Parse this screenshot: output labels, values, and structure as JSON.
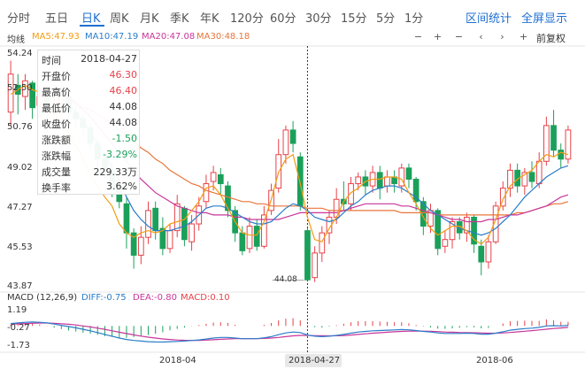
{
  "tabs": [
    {
      "label": "分时"
    },
    {
      "label": "五日"
    },
    {
      "label": "日K"
    },
    {
      "label": "周K"
    },
    {
      "label": "月K"
    },
    {
      "label": "季K"
    },
    {
      "label": "年K"
    },
    {
      "label": "120分"
    },
    {
      "label": "60分"
    },
    {
      "label": "30分"
    },
    {
      "label": "15分"
    },
    {
      "label": "5分"
    },
    {
      "label": "1分"
    }
  ],
  "active_tab": "日K",
  "right_links": {
    "range_stats": "区间统计",
    "fullscreen": "全屏显示"
  },
  "ma_legend": {
    "title": "均线",
    "ma5": "MA5:47.93",
    "ma10": "MA10:47.19",
    "ma20": "MA20:47.08",
    "ma30": "MA30:48.18"
  },
  "controls": {
    "minus1": "−",
    "plus1": "+",
    "minus2": "−",
    "prev": "‹",
    "next": "›",
    "plus2": "+",
    "fuquan": "前复权"
  },
  "colors": {
    "ma5": "#f39c12",
    "ma10": "#2a7dc9",
    "ma20": "#c8369a",
    "ma30": "#e8753a",
    "up": "#e8424a",
    "down": "#1aa05a",
    "diff": "#2a7dc9",
    "dea": "#c8369a",
    "macd": "#e8424a"
  },
  "price_axis": {
    "labels": [
      "54.24",
      "52.50",
      "50.76",
      "49.02",
      "47.27",
      "45.53",
      "43.87"
    ]
  },
  "macd_axis": {
    "labels": [
      "1.19",
      "-0.27",
      "-1.73"
    ]
  },
  "x_axis": {
    "labels": [
      "2018-04",
      "2018-04-27",
      "2018-06"
    ]
  },
  "low_marker": "44.08",
  "tooltip": [
    {
      "key": "时间",
      "value": "2018-04-27",
      "color": "#333"
    },
    {
      "key": "开盘价",
      "value": "46.30",
      "color": "#e8424a"
    },
    {
      "key": "最高价",
      "value": "46.40",
      "color": "#e8424a"
    },
    {
      "key": "最低价",
      "value": "44.08",
      "color": "#333"
    },
    {
      "key": "收盘价",
      "value": "44.08",
      "color": "#333"
    },
    {
      "key": "涨跌额",
      "value": "-1.50",
      "color": "#1aa05a"
    },
    {
      "key": "涨跌幅",
      "value": "-3.29%",
      "color": "#1aa05a"
    },
    {
      "key": "成交量",
      "value": "229.33万",
      "color": "#333"
    },
    {
      "key": "换手率",
      "value": "3.62%",
      "color": "#333"
    }
  ],
  "macd_legend": {
    "title": "MACD (12,26,9)",
    "diff": "DIFF:-0.75",
    "dea": "DEA:-0.80",
    "macd": "MACD:0.10"
  },
  "chart_data": [
    {
      "type": "candlestick",
      "ylim": [
        43.87,
        54.24
      ],
      "candles": [
        [
          51.6,
          53.3,
          53.9,
          51.0
        ],
        [
          52.8,
          52.4,
          53.3,
          51.5
        ],
        [
          52.3,
          53.0,
          53.3,
          51.7
        ],
        [
          52.9,
          51.8,
          53.0,
          51.3
        ],
        [
          51.9,
          52.3,
          52.8,
          51.4
        ],
        [
          52.3,
          51.8,
          52.5,
          51.2
        ],
        [
          51.7,
          52.0,
          52.4,
          51.1
        ],
        [
          52.0,
          52.5,
          52.8,
          51.8
        ],
        [
          52.3,
          51.6,
          52.4,
          51.2
        ],
        [
          51.6,
          51.3,
          51.9,
          50.9
        ],
        [
          51.3,
          50.9,
          51.5,
          50.5
        ],
        [
          50.9,
          50.2,
          51.1,
          49.9
        ],
        [
          50.2,
          49.5,
          50.4,
          49.1
        ],
        [
          49.5,
          49.0,
          49.8,
          48.6
        ],
        [
          49.0,
          48.2,
          49.3,
          47.8
        ],
        [
          48.2,
          47.6,
          48.6,
          47.3
        ],
        [
          47.5,
          46.2,
          47.8,
          45.5
        ],
        [
          46.2,
          45.2,
          46.4,
          44.6
        ],
        [
          45.2,
          46.0,
          46.5,
          44.8
        ],
        [
          46.0,
          47.2,
          47.6,
          45.7
        ],
        [
          47.3,
          46.3,
          47.6,
          45.9
        ],
        [
          46.4,
          45.5,
          46.9,
          45.2
        ],
        [
          45.5,
          46.3,
          46.6,
          45.3
        ],
        [
          46.3,
          47.5,
          47.9,
          46.0
        ],
        [
          47.3,
          45.9,
          47.4,
          45.6
        ],
        [
          45.8,
          46.6,
          47.0,
          45.4
        ],
        [
          46.6,
          47.4,
          47.8,
          46.3
        ],
        [
          47.6,
          48.4,
          48.8,
          47.3
        ],
        [
          48.5,
          48.9,
          49.2,
          48.1
        ],
        [
          48.8,
          48.4,
          49.1,
          47.9
        ],
        [
          48.3,
          47.2,
          48.5,
          46.9
        ],
        [
          47.2,
          46.2,
          47.4,
          45.8
        ],
        [
          46.2,
          45.4,
          46.5,
          45.2
        ],
        [
          45.5,
          46.5,
          46.9,
          45.3
        ],
        [
          46.5,
          45.6,
          46.8,
          45.4
        ],
        [
          45.6,
          47.0,
          47.4,
          45.5
        ],
        [
          47.2,
          48.1,
          48.4,
          47.0
        ],
        [
          48.2,
          49.7,
          50.4,
          48.0
        ],
        [
          49.7,
          50.8,
          51.0,
          49.3
        ],
        [
          50.8,
          50.2,
          51.2,
          49.8
        ],
        [
          49.6,
          47.4,
          49.8,
          47.2
        ],
        [
          46.3,
          44.1,
          46.4,
          44.1
        ],
        [
          44.2,
          45.3,
          45.6,
          44.0
        ],
        [
          45.3,
          46.2,
          46.5,
          44.9
        ],
        [
          46.2,
          46.9,
          47.2,
          45.7
        ],
        [
          46.9,
          47.7,
          48.2,
          46.6
        ],
        [
          47.7,
          47.5,
          48.5,
          47.2
        ],
        [
          47.5,
          48.4,
          48.7,
          47.2
        ],
        [
          48.4,
          48.7,
          48.9,
          48.1
        ],
        [
          48.7,
          48.3,
          49.0,
          47.9
        ],
        [
          48.3,
          48.9,
          49.2,
          48.0
        ],
        [
          48.9,
          48.2,
          49.2,
          47.7
        ],
        [
          48.3,
          48.7,
          49.0,
          48.0
        ],
        [
          48.7,
          48.4,
          49.0,
          48.0
        ],
        [
          48.3,
          49.1,
          49.3,
          48.0
        ],
        [
          49.1,
          48.6,
          49.3,
          48.2
        ],
        [
          48.6,
          47.6,
          48.7,
          47.2
        ],
        [
          47.6,
          46.5,
          47.8,
          46.1
        ],
        [
          46.5,
          47.2,
          47.5,
          46.2
        ],
        [
          47.2,
          45.5,
          47.3,
          45.2
        ],
        [
          45.6,
          45.9,
          46.3,
          45.3
        ],
        [
          45.9,
          46.7,
          46.9,
          45.5
        ],
        [
          46.7,
          46.2,
          46.9,
          45.9
        ],
        [
          46.2,
          46.9,
          47.1,
          45.8
        ],
        [
          46.9,
          45.7,
          47.0,
          45.3
        ],
        [
          45.6,
          44.9,
          45.9,
          44.3
        ],
        [
          44.9,
          45.8,
          46.1,
          44.6
        ],
        [
          45.8,
          47.4,
          47.6,
          45.7
        ],
        [
          47.4,
          48.2,
          48.5,
          47.2
        ],
        [
          48.2,
          49.0,
          49.3,
          47.8
        ],
        [
          49.0,
          48.3,
          49.3,
          48.0
        ],
        [
          48.3,
          48.9,
          49.1,
          47.9
        ],
        [
          48.9,
          48.5,
          49.4,
          48.2
        ],
        [
          48.4,
          49.4,
          49.8,
          48.2
        ],
        [
          49.4,
          51.0,
          51.4,
          49.2
        ],
        [
          51.0,
          49.9,
          51.7,
          49.6
        ],
        [
          49.9,
          49.5,
          50.2,
          49.1
        ],
        [
          49.5,
          50.8,
          51.0,
          49.3
        ]
      ],
      "ma5": [
        52.4,
        52.6,
        52.8,
        52.6,
        52.5,
        52.2,
        51.6,
        51.2,
        50.7,
        50.1,
        49.5,
        48.8,
        48.3,
        47.8,
        47.4,
        46.6,
        46.2,
        46.0,
        46.2,
        46.3,
        46.2,
        46.3,
        46.6,
        46.7,
        46.8,
        47.2,
        47.6,
        48.2,
        48.3,
        47.9,
        47.3,
        46.7,
        46.2,
        46.1,
        46.1,
        46.7,
        47.7,
        48.9,
        49.5,
        49.7,
        48.4,
        46.9,
        45.9,
        45.8,
        46.4,
        46.9,
        47.6,
        48.0,
        48.2,
        48.5,
        48.6,
        48.6,
        48.7,
        48.7,
        48.6,
        48.0,
        47.5,
        46.9,
        46.4,
        46.1,
        46.3,
        46.5,
        46.5,
        46.3,
        45.9,
        45.7,
        46.0,
        46.8,
        47.7,
        48.3,
        48.6,
        48.8,
        49.0,
        49.4,
        49.7,
        49.6,
        49.8,
        49.7
      ],
      "ma10": [
        null,
        null,
        null,
        null,
        null,
        null,
        null,
        52.2,
        52.0,
        51.6,
        51.2,
        50.7,
        50.2,
        49.7,
        49.1,
        48.5,
        47.8,
        47.2,
        46.8,
        46.5,
        46.3,
        46.3,
        46.3,
        46.4,
        46.5,
        46.7,
        47.0,
        47.3,
        47.4,
        47.4,
        47.3,
        47.1,
        46.9,
        46.7,
        46.6,
        46.6,
        46.7,
        47.0,
        47.3,
        47.5,
        47.4,
        47.2,
        46.9,
        46.8,
        46.7,
        46.8,
        47.1,
        47.4,
        47.6,
        47.9,
        48.1,
        48.2,
        48.3,
        48.3,
        48.2,
        48.0,
        47.8,
        47.5,
        47.2,
        47.0,
        46.8,
        46.6,
        46.4,
        46.3,
        46.2,
        46.1,
        46.2,
        46.4,
        46.7,
        47.0,
        47.4,
        47.8,
        48.1,
        48.4,
        48.7,
        48.9,
        49.1,
        49.2
      ],
      "ma20": [
        null,
        null,
        null,
        null,
        null,
        null,
        52.8,
        52.6,
        52.3,
        52.0,
        51.7,
        51.4,
        51.0,
        50.6,
        50.2,
        49.8,
        49.4,
        49.0,
        48.6,
        48.3,
        48.0,
        47.8,
        47.6,
        47.4,
        47.3,
        47.2,
        47.1,
        47.1,
        47.0,
        47.0,
        47.0,
        46.9,
        46.9,
        46.8,
        46.8,
        46.8,
        46.8,
        46.8,
        46.9,
        47.0,
        47.1,
        47.1,
        47.1,
        47.1,
        47.1,
        47.1,
        47.2,
        47.3,
        47.4,
        47.5,
        47.5,
        47.5,
        47.5,
        47.5,
        47.4,
        47.4,
        47.3,
        47.2,
        47.1,
        47.0,
        46.9,
        46.8,
        46.8,
        46.7,
        46.7,
        46.7,
        46.8,
        46.8,
        46.9,
        47.0,
        47.0,
        47.1,
        47.2,
        47.3,
        47.4,
        47.6,
        47.8,
        47.9
      ],
      "ma30": [
        null,
        null,
        null,
        null,
        null,
        null,
        null,
        null,
        52.1,
        52.0,
        51.8,
        51.7,
        51.5,
        51.3,
        51.1,
        50.8,
        50.6,
        50.3,
        50.0,
        49.8,
        49.5,
        49.3,
        49.0,
        48.8,
        48.6,
        48.4,
        48.3,
        48.1,
        48.0,
        47.9,
        47.8,
        47.7,
        47.6,
        47.6,
        47.5,
        47.5,
        47.4,
        47.4,
        47.4,
        47.4,
        47.4,
        47.3,
        47.3,
        47.3,
        47.2,
        47.2,
        47.2,
        47.2,
        47.2,
        47.2,
        47.2,
        47.2,
        47.2,
        47.2,
        47.1,
        47.1,
        47.1,
        47.1,
        47.1,
        47.0,
        47.0,
        47.0,
        47.0,
        47.0,
        47.0,
        47.0,
        47.0,
        47.0,
        47.0,
        47.0,
        47.1,
        47.1,
        47.2,
        47.3,
        47.4,
        47.5,
        47.5,
        47.6
      ]
    },
    {
      "type": "macd",
      "ylim": [
        -1.73,
        1.19
      ],
      "diff": [
        0.2,
        0.25,
        0.3,
        0.32,
        0.3,
        0.25,
        0.15,
        0.05,
        -0.05,
        -0.15,
        -0.28,
        -0.4,
        -0.55,
        -0.7,
        -0.85,
        -1.0,
        -1.12,
        -1.2,
        -1.25,
        -1.3,
        -1.32,
        -1.33,
        -1.3,
        -1.28,
        -1.25,
        -1.2,
        -1.15,
        -1.08,
        -1.0,
        -0.95,
        -0.95,
        -1.0,
        -1.05,
        -1.05,
        -1.05,
        -0.98,
        -0.88,
        -0.72,
        -0.58,
        -0.5,
        -0.55,
        -0.75,
        -0.85,
        -0.88,
        -0.85,
        -0.78,
        -0.7,
        -0.6,
        -0.5,
        -0.45,
        -0.4,
        -0.38,
        -0.35,
        -0.33,
        -0.3,
        -0.32,
        -0.38,
        -0.45,
        -0.5,
        -0.58,
        -0.62,
        -0.62,
        -0.62,
        -0.6,
        -0.62,
        -0.68,
        -0.68,
        -0.6,
        -0.48,
        -0.35,
        -0.28,
        -0.22,
        -0.18,
        -0.12,
        0.0,
        0.02,
        0.0,
        0.05
      ],
      "dea": [
        0.15,
        0.17,
        0.2,
        0.22,
        0.24,
        0.24,
        0.22,
        0.18,
        0.14,
        0.08,
        0.0,
        -0.08,
        -0.18,
        -0.28,
        -0.4,
        -0.52,
        -0.63,
        -0.74,
        -0.84,
        -0.93,
        -1.0,
        -1.07,
        -1.12,
        -1.16,
        -1.18,
        -1.19,
        -1.19,
        -1.17,
        -1.14,
        -1.1,
        -1.07,
        -1.05,
        -1.05,
        -1.05,
        -1.05,
        -1.03,
        -1.0,
        -0.95,
        -0.88,
        -0.82,
        -0.78,
        -0.78,
        -0.8,
        -0.81,
        -0.82,
        -0.81,
        -0.79,
        -0.75,
        -0.7,
        -0.65,
        -0.6,
        -0.56,
        -0.52,
        -0.48,
        -0.45,
        -0.43,
        -0.42,
        -0.43,
        -0.44,
        -0.47,
        -0.5,
        -0.52,
        -0.54,
        -0.55,
        -0.56,
        -0.58,
        -0.6,
        -0.6,
        -0.58,
        -0.54,
        -0.49,
        -0.44,
        -0.39,
        -0.33,
        -0.27,
        -0.21,
        -0.17,
        -0.12
      ]
    }
  ]
}
